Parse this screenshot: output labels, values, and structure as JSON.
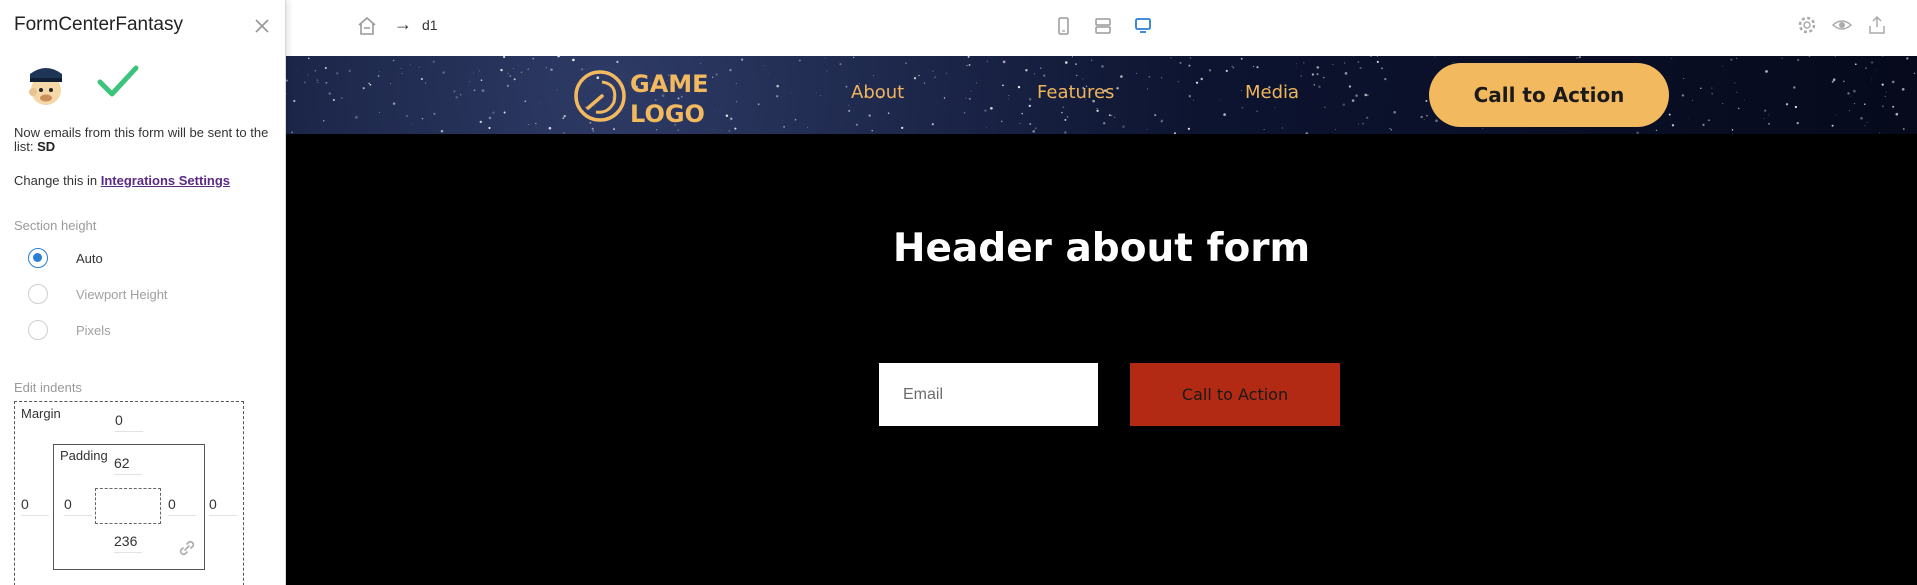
{
  "panel": {
    "title": "FormCenterFantasy",
    "info_text": "Now emails from this form will be sent to the list:",
    "list_name": "SD",
    "change_prefix": "Change this in",
    "change_link": "Integrations Settings",
    "section_height_label": "Section height",
    "height_options": [
      {
        "label": "Auto",
        "selected": true
      },
      {
        "label": "Viewport Height",
        "selected": false
      },
      {
        "label": "Pixels",
        "selected": false
      }
    ],
    "edit_indents_label": "Edit indents",
    "margin_label": "Margin",
    "padding_label": "Padding",
    "margin": {
      "top": "0",
      "left": "0",
      "right": "0"
    },
    "padding": {
      "top": "62",
      "left": "0",
      "right": "0",
      "bottom": "236"
    },
    "icons": {
      "close": "close-icon",
      "avatar": "mailchimp-icon",
      "check": "check-icon",
      "link": "link-icon"
    },
    "accent_color": "#2a7fd4",
    "check_color": "#3cc47c"
  },
  "topbar": {
    "breadcrumb_arrow": "→",
    "breadcrumb": "d1",
    "devices": [
      "phone-icon",
      "tablet-icon",
      "desktop-icon"
    ],
    "active_device": "desktop-icon",
    "tools": [
      "settings-icon",
      "preview-eye-icon",
      "publish-icon"
    ]
  },
  "site": {
    "logo_text_line1": "GAME",
    "logo_text_line2": "LOGO",
    "nav_links": [
      "About",
      "Features",
      "Media"
    ],
    "nav_cta": "Call to Action",
    "hero_title": "Header about form",
    "email_placeholder": "Email",
    "form_cta": "Call to Action",
    "colors": {
      "gold": "#f2b95f",
      "cta_red": "#b22a14",
      "body_bg": "#000000"
    }
  }
}
